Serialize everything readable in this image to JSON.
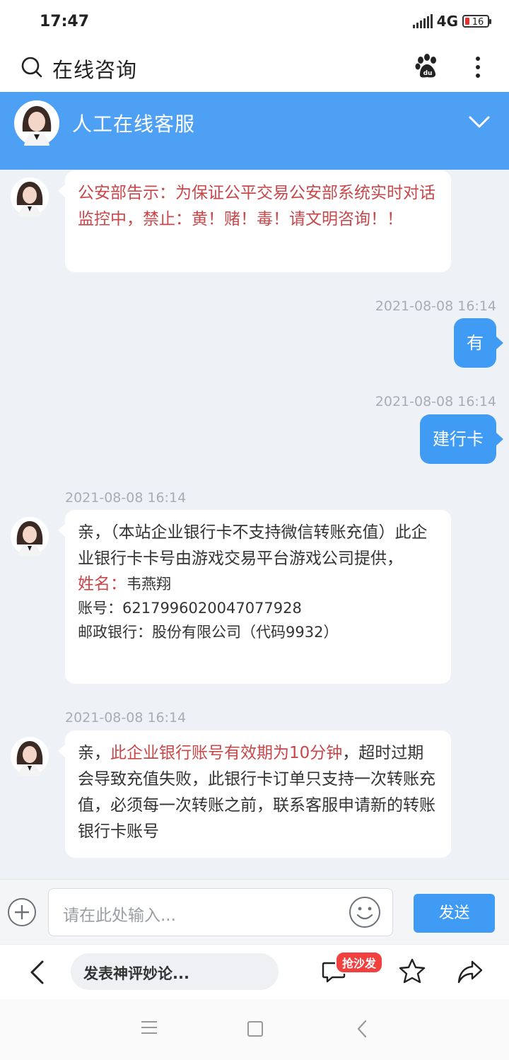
{
  "status_bar": {
    "time": "17:47",
    "network": "4G",
    "battery": "16"
  },
  "topbar": {
    "title": "在线咨询"
  },
  "chat_header": {
    "name": "人工在线客服"
  },
  "messages": {
    "m1": {
      "text": "公安部告示：为保证公平交易公安部系统实时对话监控中，禁止：黄！赌！毒！请文明咨询！！"
    },
    "m2": {
      "time": "2021-08-08 16:14",
      "text": "有"
    },
    "m3": {
      "time": "2021-08-08 16:14",
      "text": "建行卡"
    },
    "m4": {
      "time": "2021-08-08 16:14",
      "intro": "亲，（本站企业银行卡不支持微信转账充值）此企业银行卡卡号由游戏交易平台游戏公司提供，",
      "name_label": "姓名：",
      "name_value": "韦燕翔",
      "account": "账号：6217996020047077928",
      "bank": "邮政银行：股份有限公司（代码9932）"
    },
    "m5": {
      "time": "2021-08-08 16:14",
      "prefix": "亲，",
      "highlight": "此企业银行账号有效期为10分钟",
      "rest": "，超时过期会导致充值失败，此银行卡订单只支持一次转账充值，必须每一次转账之前，联系客服申请新的转账银行卡账号"
    }
  },
  "input": {
    "placeholder": "请在此处输入...",
    "send_label": "发送"
  },
  "bottombar": {
    "comment_placeholder": "发表神评妙论...",
    "badge": "抢沙发"
  },
  "colors": {
    "accent": "#3f9bf3",
    "header": "#4ea0f5",
    "warning_text": "#c8474a",
    "chat_bg": "#eef2f7"
  },
  "icons": [
    "search-icon",
    "baidu-paw-icon",
    "more-vertical-icon",
    "chevron-down-icon",
    "plus-icon",
    "emoji-icon",
    "back-icon",
    "comment-icon",
    "star-icon",
    "share-icon",
    "menu-icon",
    "home-icon",
    "nav-back-icon"
  ]
}
